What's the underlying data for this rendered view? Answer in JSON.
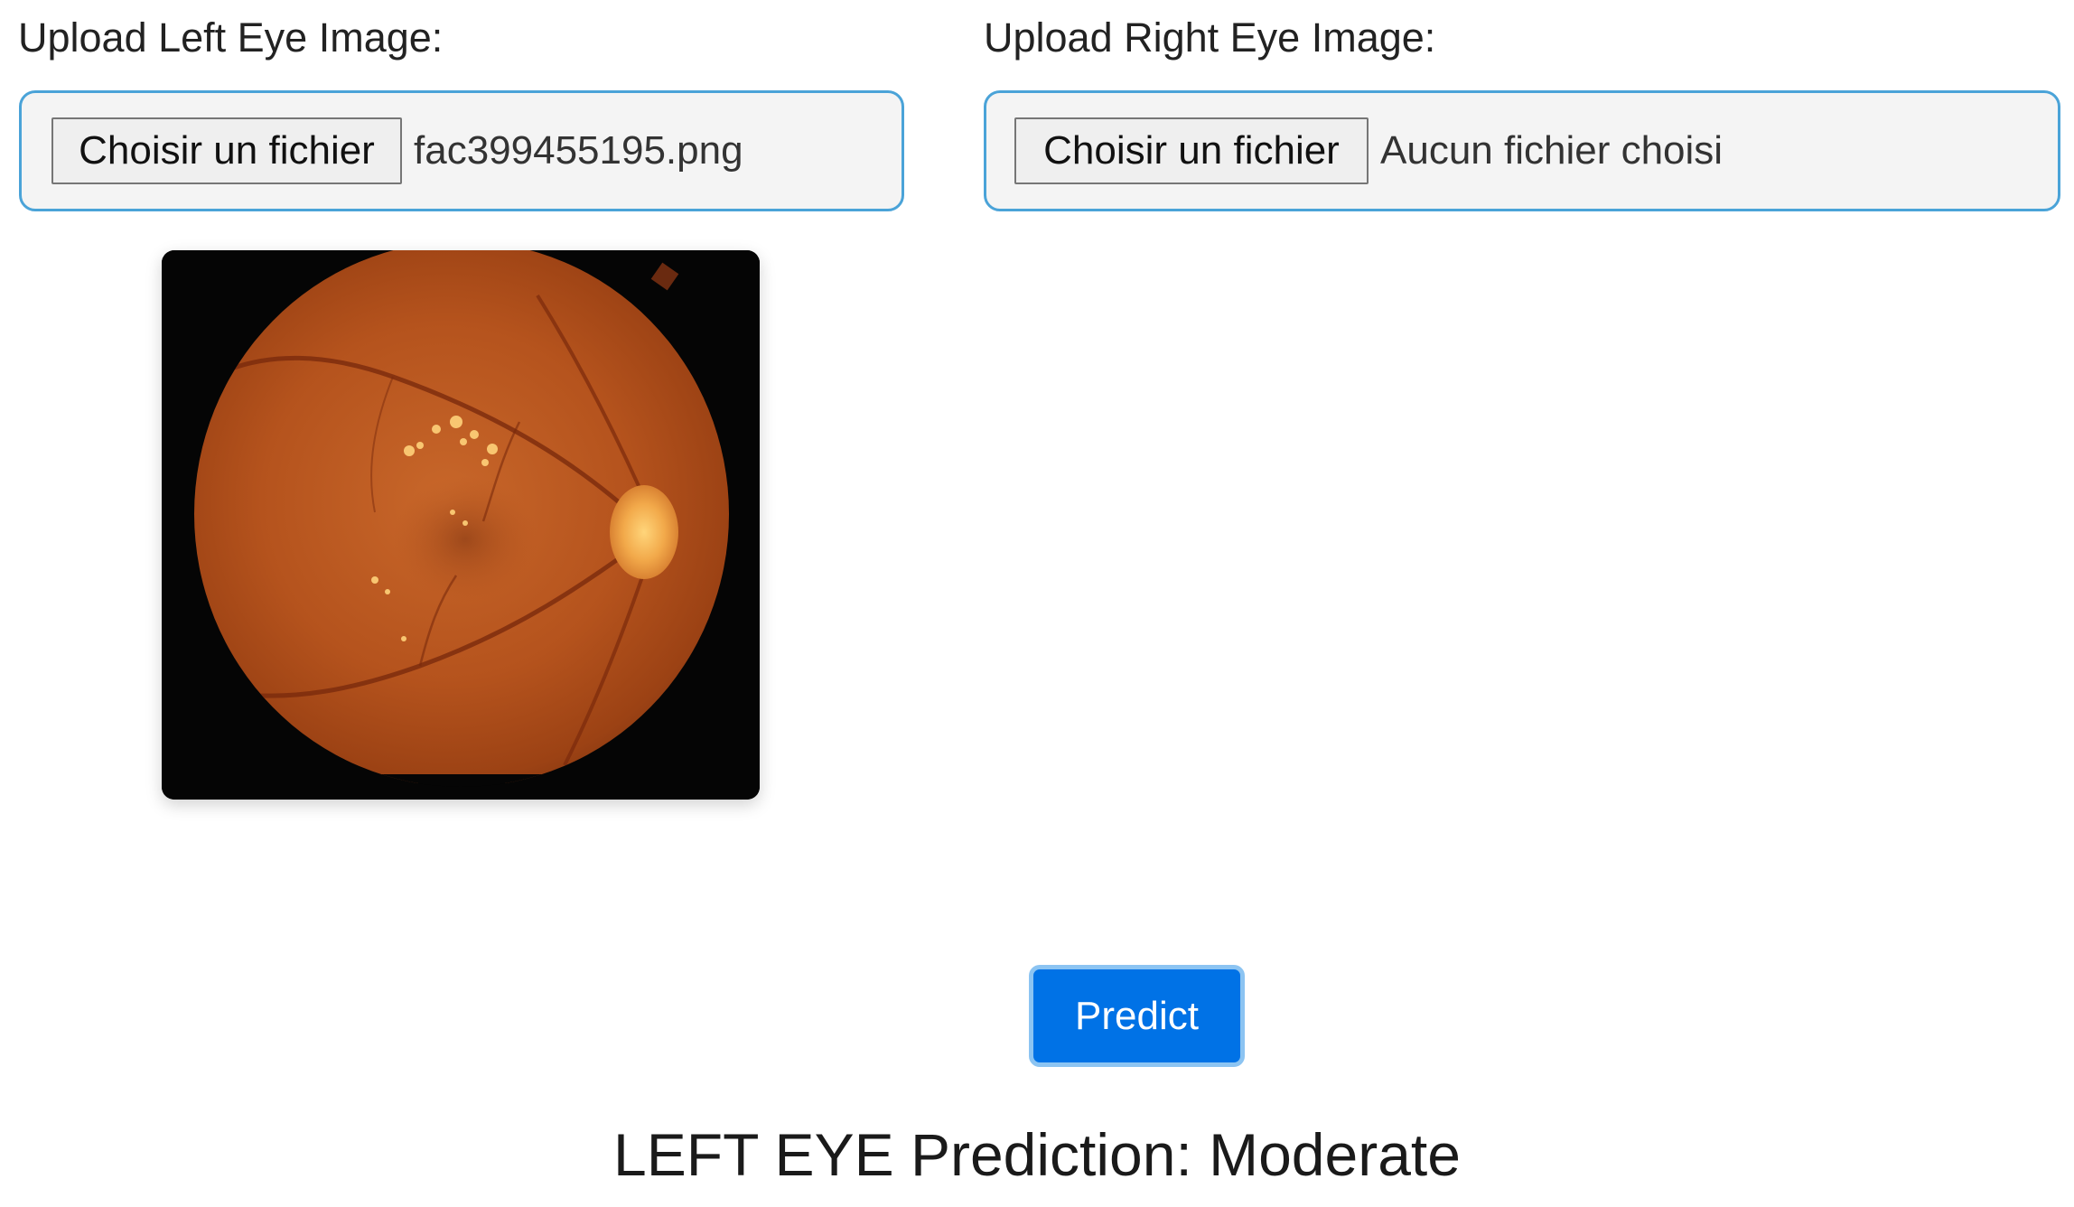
{
  "left_eye": {
    "label": "Upload Left Eye Image:",
    "choose_button": "Choisir un fichier",
    "file_name": "fac399455195.png"
  },
  "right_eye": {
    "label": "Upload Right Eye Image:",
    "choose_button": "Choisir un fichier",
    "file_name": "Aucun fichier choisi"
  },
  "predict_button": "Predict",
  "result": "LEFT EYE Prediction: Moderate",
  "colors": {
    "accent": "#0072e6",
    "input_border": "#4aa3d8"
  }
}
